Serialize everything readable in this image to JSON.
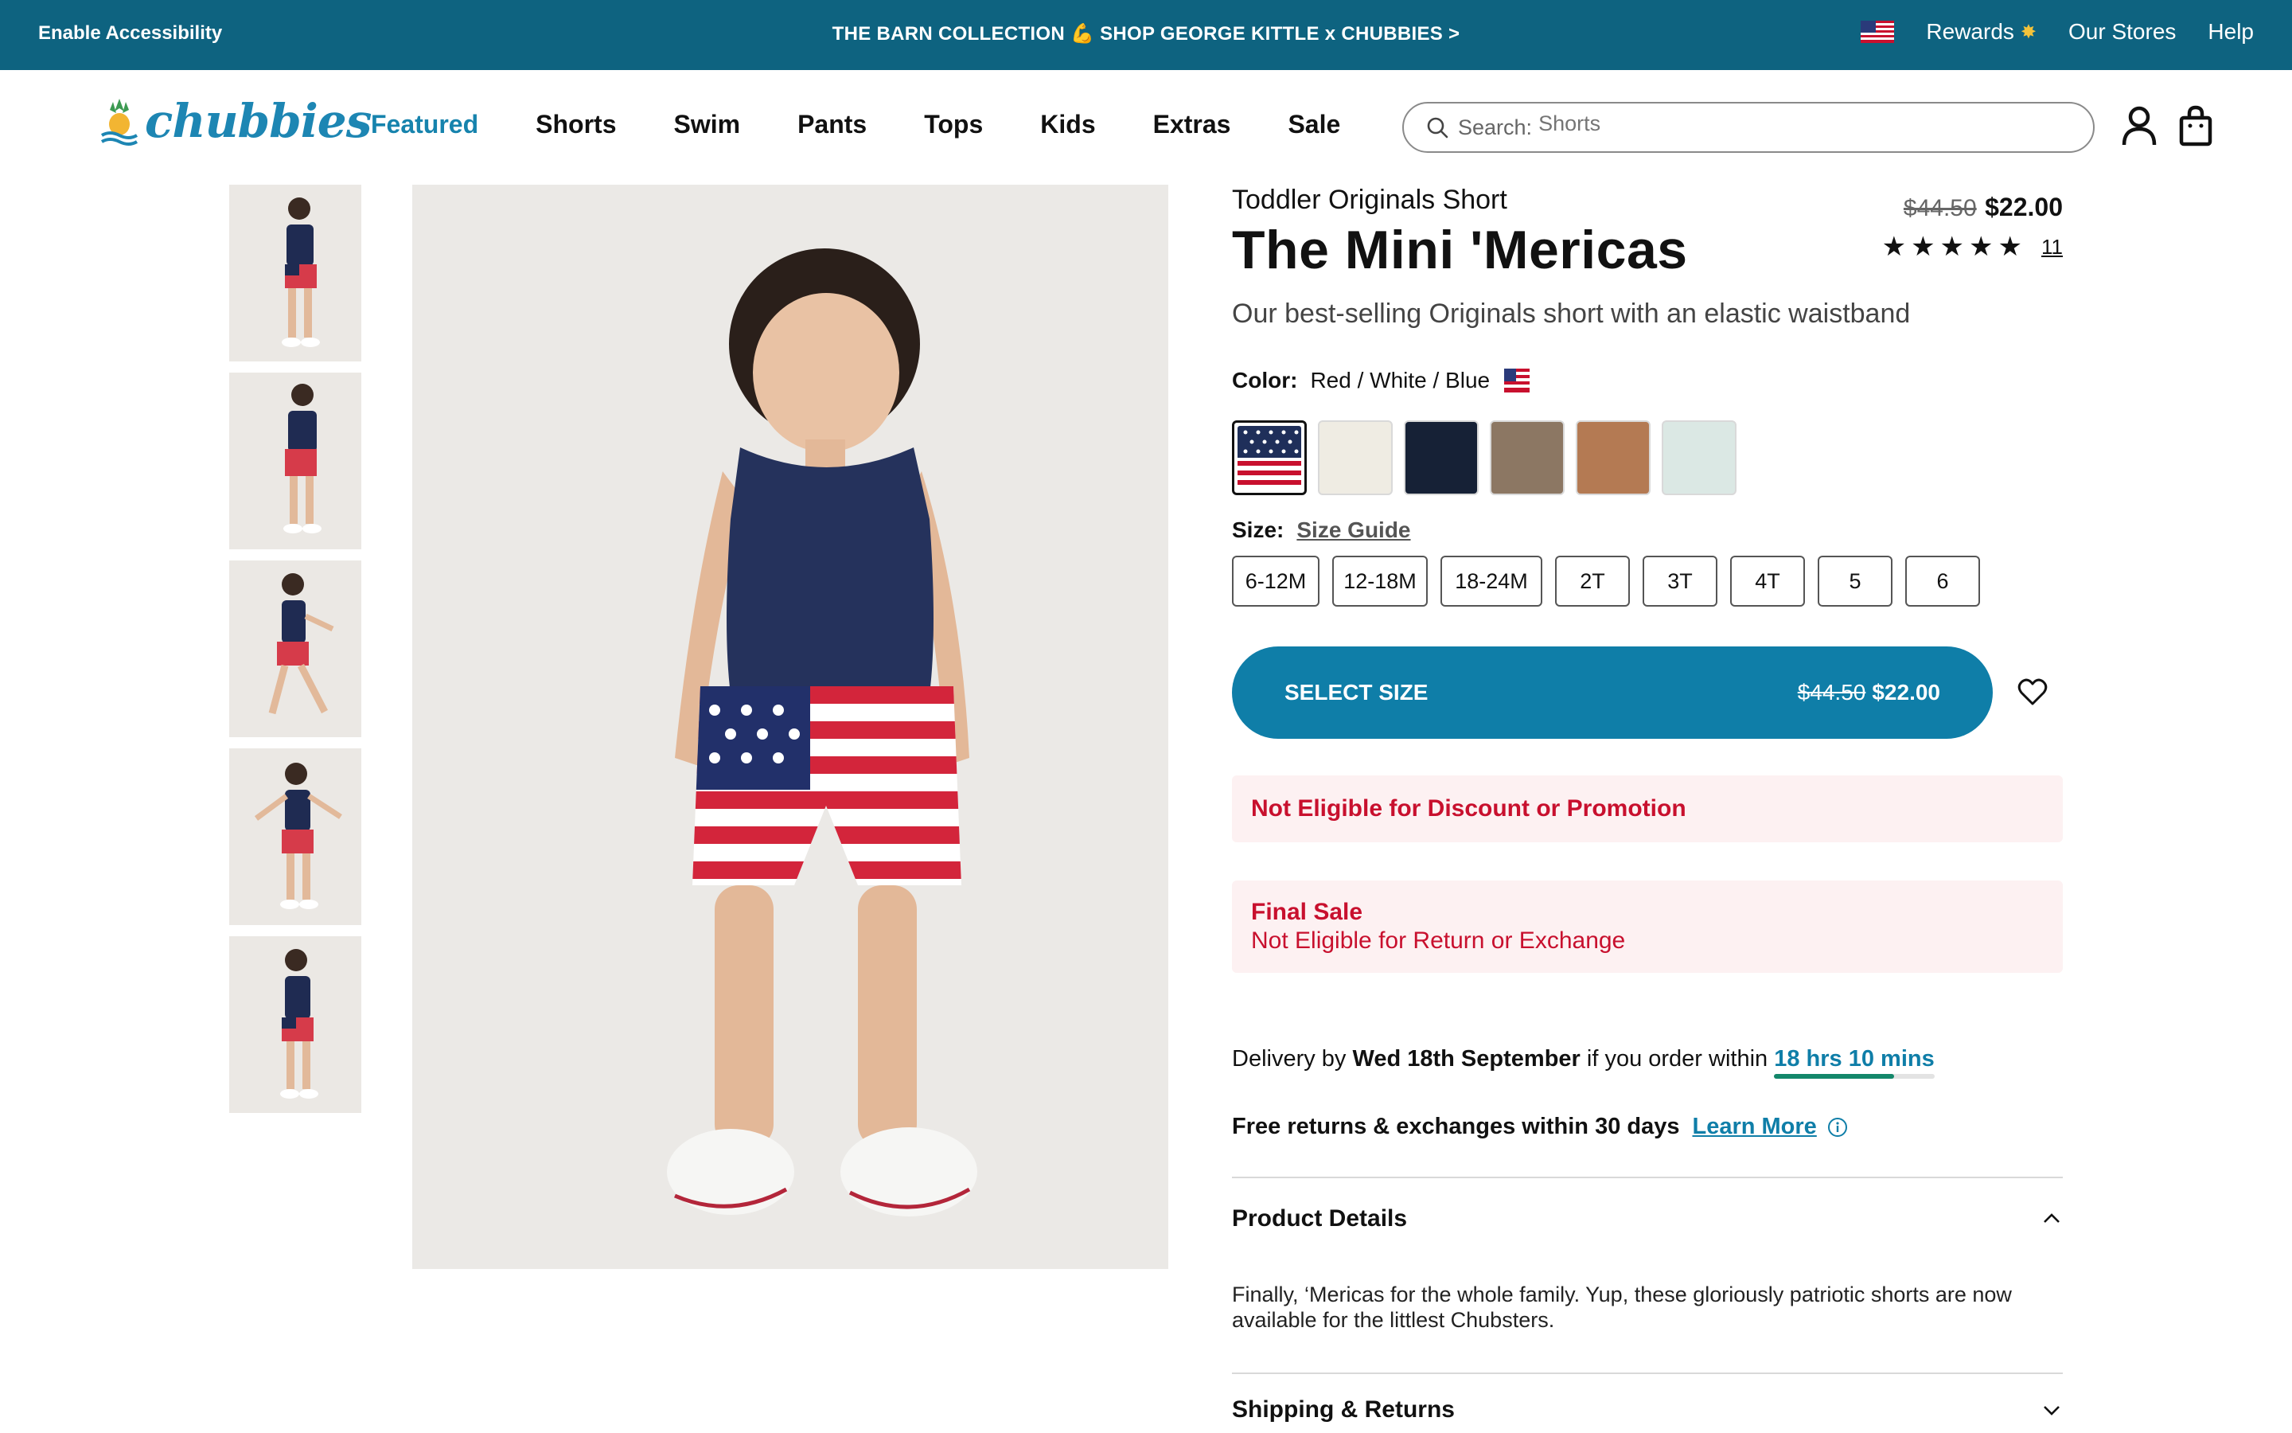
{
  "topbar": {
    "accessibility": "Enable Accessibility",
    "promo": "THE BARN COLLECTION 💪 SHOP GEORGE KITTLE x CHUBBIES >",
    "rewards": "Rewards",
    "stores": "Our Stores",
    "help": "Help"
  },
  "brand": {
    "name": "chubbies",
    "color": "#1d86b3"
  },
  "nav": {
    "items": [
      "Featured",
      "Shorts",
      "Swim",
      "Pants",
      "Tops",
      "Kids",
      "Extras",
      "Sale"
    ]
  },
  "search": {
    "label": "Search:",
    "placeholder": "Shorts"
  },
  "product": {
    "subtitle": "Toddler Originals Short",
    "title": "The Mini 'Mericas",
    "old_price": "$44.50",
    "price": "$22.00",
    "rating": 5,
    "review_count": "11",
    "description": "Our best-selling Originals short with an elastic waistband",
    "color_label": "Color:",
    "color_value": "Red / White / Blue",
    "swatches": [
      {
        "name": "Red / White / Blue",
        "color": "#1f2f5a"
      },
      {
        "name": "Cream",
        "color": "#efece3"
      },
      {
        "name": "Navy",
        "color": "#162136"
      },
      {
        "name": "Taupe",
        "color": "#8c7763"
      },
      {
        "name": "Caramel",
        "color": "#b47a53"
      },
      {
        "name": "Mint",
        "color": "#dbe8e4"
      }
    ],
    "size_label": "Size:",
    "size_guide": "Size Guide",
    "sizes": [
      "6-12M",
      "12-18M",
      "18-24M",
      "2T",
      "3T",
      "4T",
      "5",
      "6"
    ],
    "cta_label": "SELECT SIZE",
    "cta_old_price": "$44.50",
    "cta_price": "$22.00"
  },
  "notices": {
    "discount": "Not Eligible for Discount or Promotion",
    "final_title": "Final Sale",
    "final_text": "Not Eligible for Return or Exchange"
  },
  "delivery": {
    "prefix": "Delivery by",
    "date": "Wed 18th September",
    "middle": "if you order within",
    "countdown": "18 hrs 10 mins",
    "countdown_progress": 0.75
  },
  "returns": {
    "text": "Free returns & exchanges within 30 days",
    "link": "Learn More"
  },
  "accordion": {
    "details_title": "Product Details",
    "details_body": "Finally, ‘Mericas for the whole family. Yup, these gloriously patriotic shorts are now available for the littlest Chubsters.",
    "shipping_title": "Shipping & Returns"
  },
  "colors": {
    "brand_blue": "#0f7ea8",
    "topbar": "#0e6380",
    "alert_red": "#c8102e",
    "alert_bg": "#fdf1f2"
  }
}
